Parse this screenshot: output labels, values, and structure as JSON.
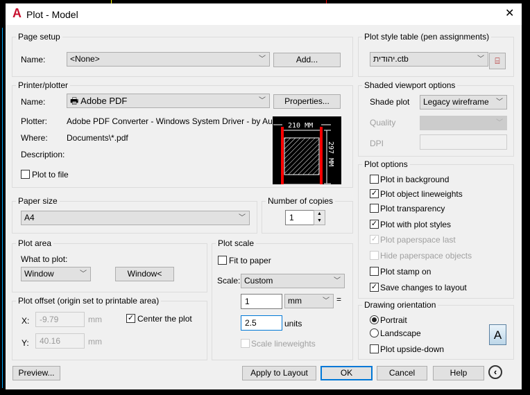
{
  "window": {
    "title": "Plot - Model",
    "close": "✕"
  },
  "page_setup": {
    "title": "Page setup",
    "name_label": "Name:",
    "name_value": "<None>",
    "add": "Add..."
  },
  "printer": {
    "title": "Printer/plotter",
    "name_label": "Name:",
    "name_value": "Adobe PDF",
    "properties": "Properties...",
    "plotter_label": "Plotter:",
    "plotter_value": "Adobe PDF Converter - Windows System Driver - by Au...",
    "where_label": "Where:",
    "where_value": "Documents\\*.pdf",
    "description_label": "Description:",
    "plot_to_file": "Plot to file",
    "plot_to_file_checked": false,
    "preview_width": "210 MM",
    "preview_height": "297 MM"
  },
  "paper_size": {
    "title": "Paper size",
    "value": "A4"
  },
  "copies": {
    "title": "Number of copies",
    "value": "1"
  },
  "plot_area": {
    "title": "Plot area",
    "what_label": "What to plot:",
    "what_value": "Window",
    "window_button": "Window<"
  },
  "plot_offset": {
    "title": "Plot offset (origin set to printable area)",
    "x_label": "X:",
    "x_value": "-9.79",
    "y_label": "Y:",
    "y_value": "40.16",
    "unit": "mm",
    "center": "Center the plot",
    "center_checked": true
  },
  "plot_scale": {
    "title": "Plot scale",
    "fit": "Fit to paper",
    "fit_checked": false,
    "scale_label": "Scale:",
    "scale_value": "Custom",
    "value1": "1",
    "unit1": "mm",
    "equals": "=",
    "value2": "2.5",
    "unit2": "units",
    "lineweights": "Scale lineweights",
    "lineweights_checked": false
  },
  "plot_style": {
    "title": "Plot style table (pen assignments)",
    "value": "יהודית.ctb"
  },
  "shaded": {
    "title": "Shaded viewport options",
    "shade_label": "Shade plot",
    "shade_value": "Legacy wireframe",
    "quality_label": "Quality",
    "quality_value": "",
    "dpi_label": "DPI",
    "dpi_value": ""
  },
  "plot_options": {
    "title": "Plot options",
    "items": [
      {
        "label": "Plot in background",
        "checked": false,
        "enabled": true
      },
      {
        "label": "Plot object lineweights",
        "checked": true,
        "enabled": true
      },
      {
        "label": "Plot transparency",
        "checked": false,
        "enabled": true
      },
      {
        "label": "Plot with plot styles",
        "checked": true,
        "enabled": true
      },
      {
        "label": "Plot paperspace last",
        "checked": true,
        "enabled": false
      },
      {
        "label": "Hide paperspace objects",
        "checked": false,
        "enabled": false
      },
      {
        "label": "Plot stamp on",
        "checked": false,
        "enabled": true
      },
      {
        "label": "Save changes to layout",
        "checked": true,
        "enabled": true
      }
    ]
  },
  "orientation": {
    "title": "Drawing orientation",
    "portrait": "Portrait",
    "landscape": "Landscape",
    "upside_down": "Plot upside-down",
    "selected": "Portrait",
    "upside_down_checked": false,
    "icon_letter": "A"
  },
  "buttons": {
    "preview": "Preview...",
    "apply": "Apply to Layout",
    "ok": "OK",
    "cancel": "Cancel",
    "help": "Help"
  },
  "colors": {
    "accent": "#0078d7",
    "autocad_red": "#c8102e",
    "preview_red": "#ff0000"
  }
}
